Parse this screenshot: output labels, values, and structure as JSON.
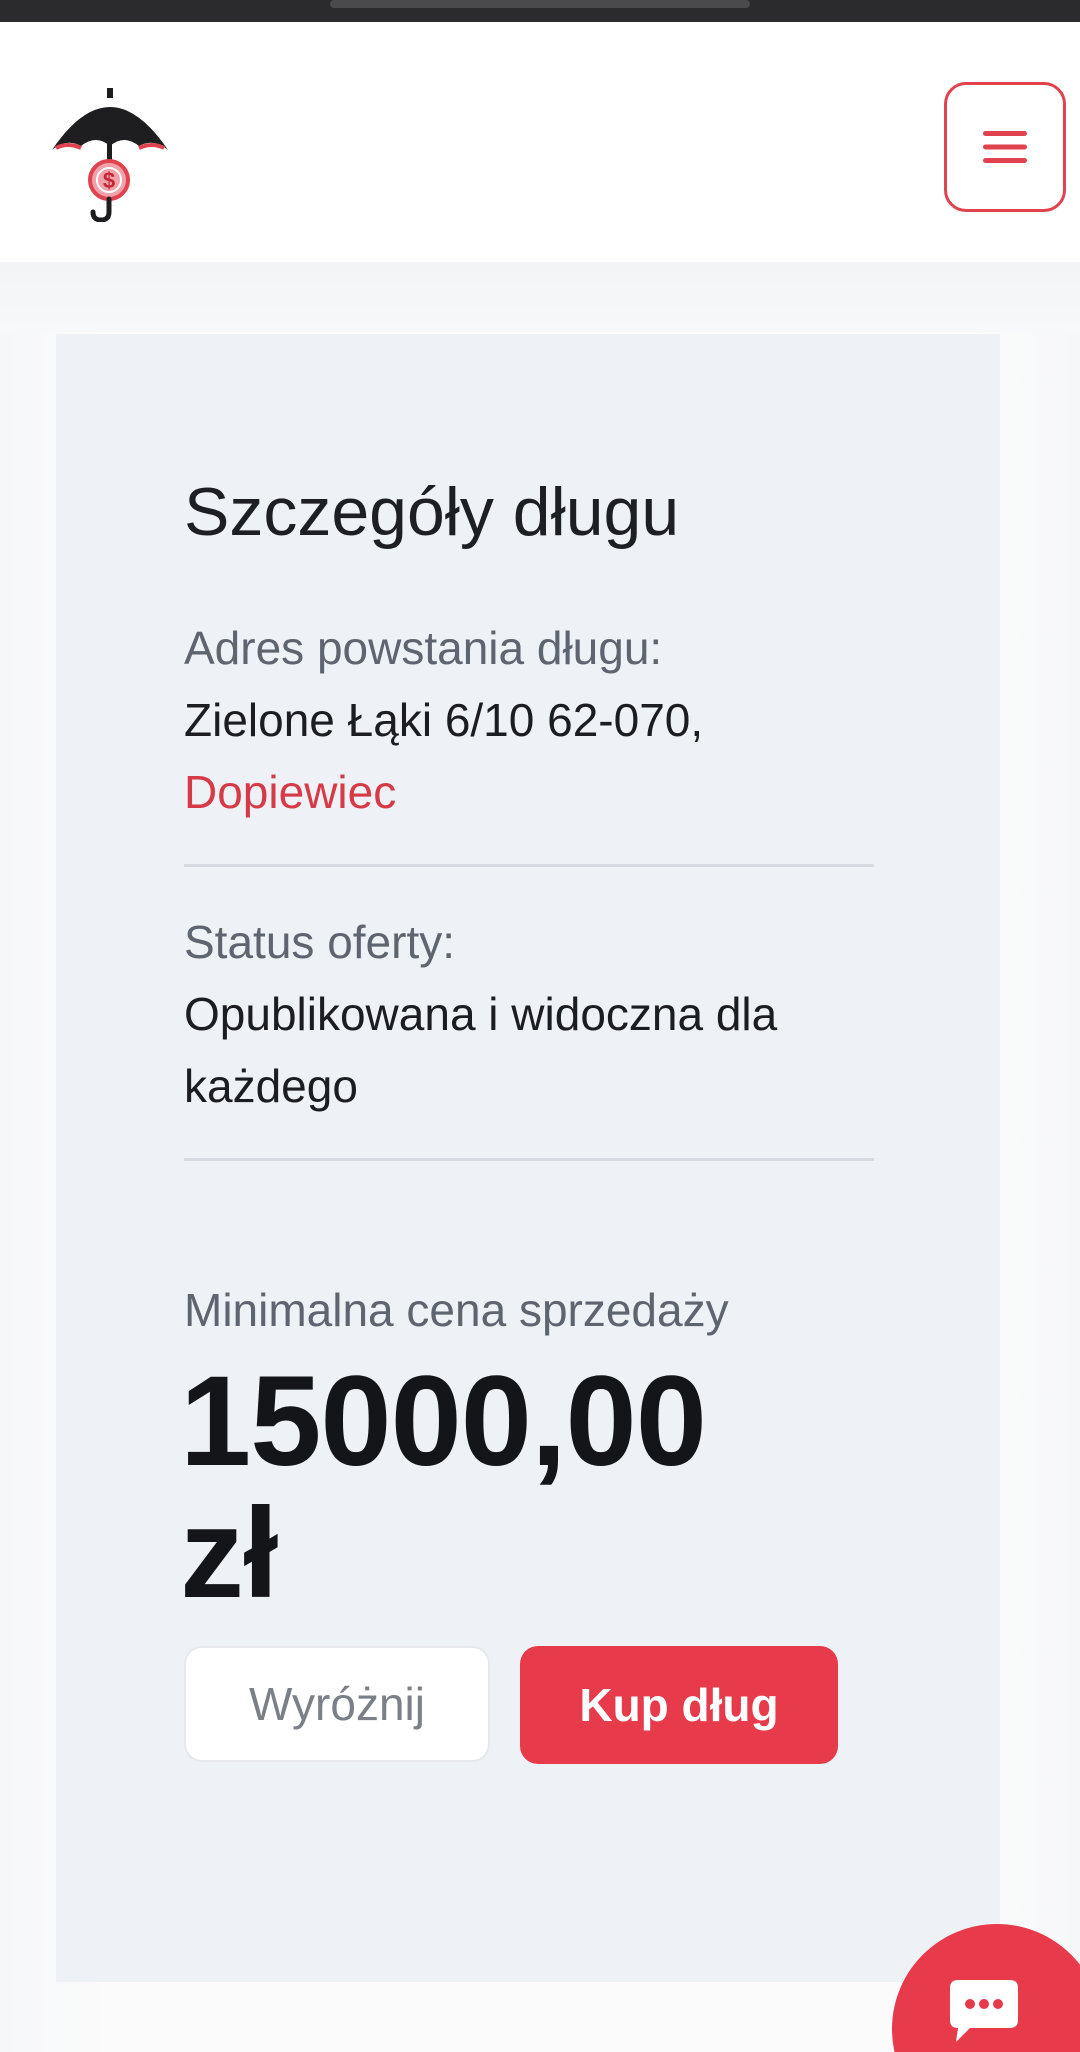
{
  "colors": {
    "accent": "#e73a4a",
    "link_red": "#d73a47",
    "card_bg": "#eef1f5",
    "muted_text": "#5e6470"
  },
  "header": {
    "logo_icon": "umbrella-dollar-logo-icon",
    "menu_icon": "hamburger-menu-icon"
  },
  "debt_details": {
    "title": "Szczegóły długu",
    "address_label": "Adres powstania długu:",
    "address_street": "Zielone Łąki 6/10 62-070,",
    "address_city": "Dopiewiec",
    "status_label": "Status oferty:",
    "status_value": "Opublikowana i widoczna dla każdego",
    "price_label": "Minimalna cena sprzedaży",
    "price_amount": "15000,00",
    "price_currency": "zł"
  },
  "actions": {
    "highlight_label": "Wyróżnij",
    "buy_label": "Kup dług"
  },
  "chat": {
    "icon": "chat-bubble-icon"
  }
}
